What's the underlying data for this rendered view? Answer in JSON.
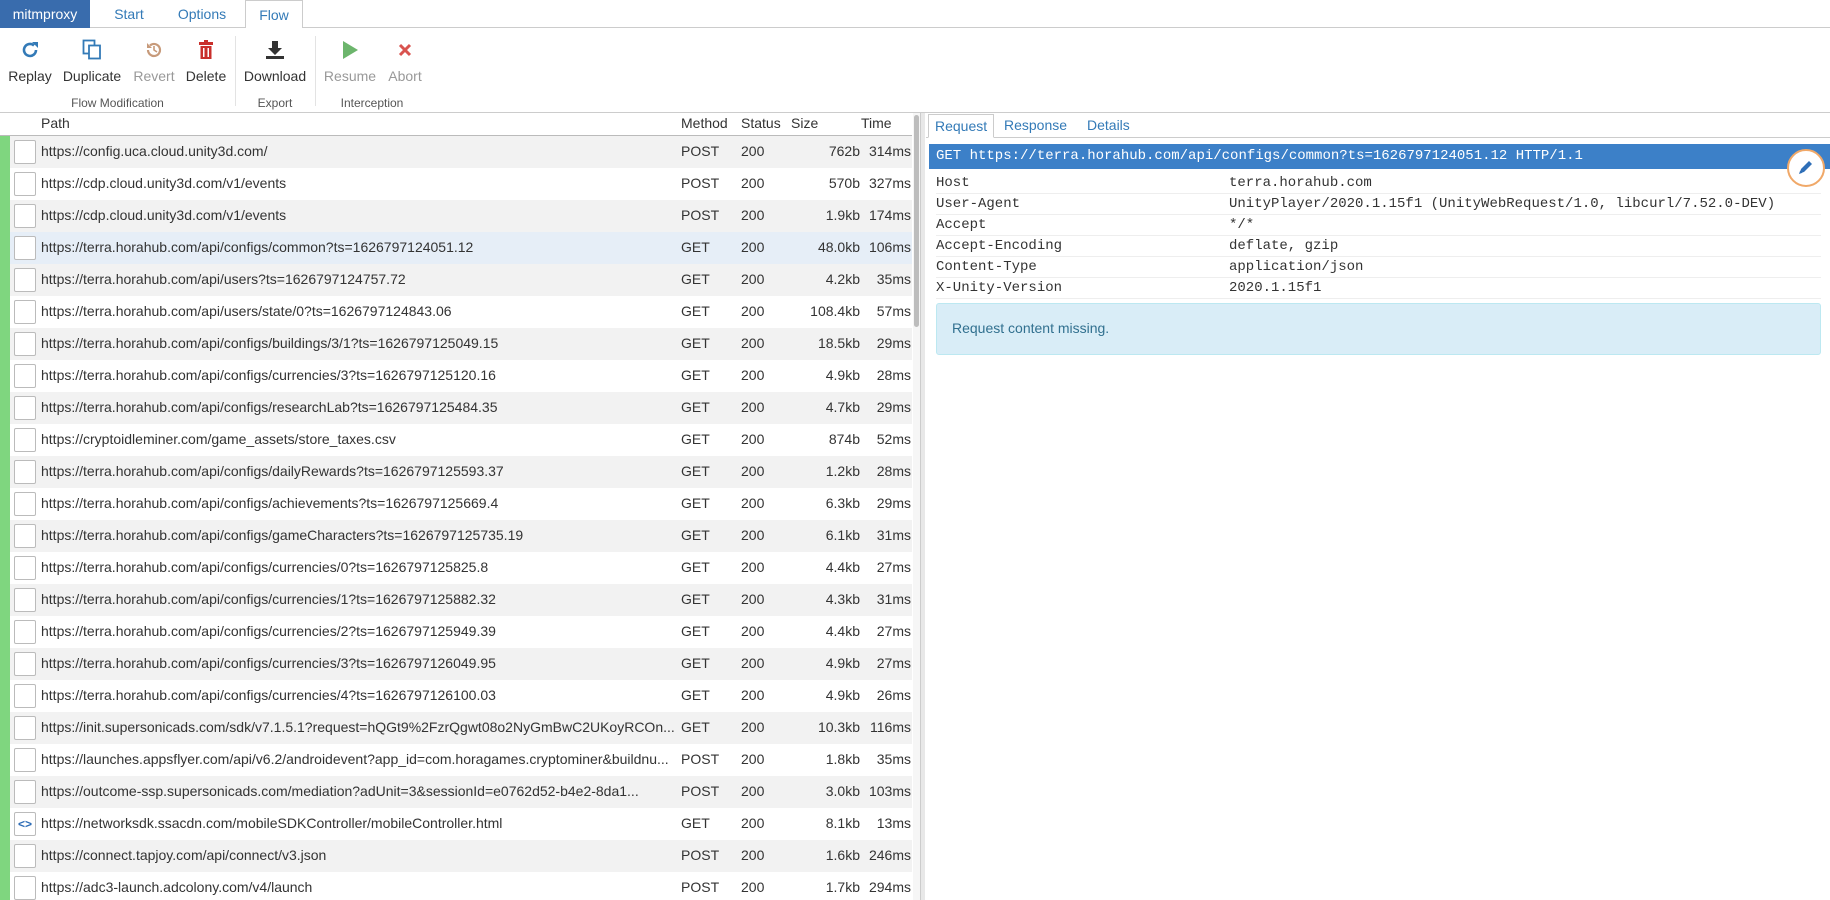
{
  "nav": {
    "brand": "mitmproxy",
    "tabs": [
      {
        "label": "Start"
      },
      {
        "label": "Options"
      },
      {
        "label": "Flow"
      }
    ]
  },
  "toolbar": {
    "replay": "Replay",
    "duplicate": "Duplicate",
    "revert": "Revert",
    "delete": "Delete",
    "download": "Download",
    "resume": "Resume",
    "abort": "Abort",
    "groups": {
      "flow_modification": "Flow Modification",
      "export": "Export",
      "interception": "Interception"
    }
  },
  "flow_table": {
    "columns": {
      "path": "Path",
      "method": "Method",
      "status": "Status",
      "size": "Size",
      "time": "Time"
    },
    "rows": [
      {
        "path": "https://config.uca.cloud.unity3d.com/",
        "method": "POST",
        "status": "200",
        "size": "762b",
        "time": "314ms"
      },
      {
        "path": "https://cdp.cloud.unity3d.com/v1/events",
        "method": "POST",
        "status": "200",
        "size": "570b",
        "time": "327ms"
      },
      {
        "path": "https://cdp.cloud.unity3d.com/v1/events",
        "method": "POST",
        "status": "200",
        "size": "1.9kb",
        "time": "174ms"
      },
      {
        "path": "https://terra.horahub.com/api/configs/common?ts=1626797124051.12",
        "method": "GET",
        "status": "200",
        "size": "48.0kb",
        "time": "106ms"
      },
      {
        "path": "https://terra.horahub.com/api/users?ts=1626797124757.72",
        "method": "GET",
        "status": "200",
        "size": "4.2kb",
        "time": "35ms"
      },
      {
        "path": "https://terra.horahub.com/api/users/state/0?ts=1626797124843.06",
        "method": "GET",
        "status": "200",
        "size": "108.4kb",
        "time": "57ms"
      },
      {
        "path": "https://terra.horahub.com/api/configs/buildings/3/1?ts=1626797125049.15",
        "method": "GET",
        "status": "200",
        "size": "18.5kb",
        "time": "29ms"
      },
      {
        "path": "https://terra.horahub.com/api/configs/currencies/3?ts=1626797125120.16",
        "method": "GET",
        "status": "200",
        "size": "4.9kb",
        "time": "28ms"
      },
      {
        "path": "https://terra.horahub.com/api/configs/researchLab?ts=1626797125484.35",
        "method": "GET",
        "status": "200",
        "size": "4.7kb",
        "time": "29ms"
      },
      {
        "path": "https://cryptoidleminer.com/game_assets/store_taxes.csv",
        "method": "GET",
        "status": "200",
        "size": "874b",
        "time": "52ms"
      },
      {
        "path": "https://terra.horahub.com/api/configs/dailyRewards?ts=1626797125593.37",
        "method": "GET",
        "status": "200",
        "size": "1.2kb",
        "time": "28ms"
      },
      {
        "path": "https://terra.horahub.com/api/configs/achievements?ts=1626797125669.4",
        "method": "GET",
        "status": "200",
        "size": "6.3kb",
        "time": "29ms"
      },
      {
        "path": "https://terra.horahub.com/api/configs/gameCharacters?ts=1626797125735.19",
        "method": "GET",
        "status": "200",
        "size": "6.1kb",
        "time": "31ms"
      },
      {
        "path": "https://terra.horahub.com/api/configs/currencies/0?ts=1626797125825.8",
        "method": "GET",
        "status": "200",
        "size": "4.4kb",
        "time": "27ms"
      },
      {
        "path": "https://terra.horahub.com/api/configs/currencies/1?ts=1626797125882.32",
        "method": "GET",
        "status": "200",
        "size": "4.3kb",
        "time": "31ms"
      },
      {
        "path": "https://terra.horahub.com/api/configs/currencies/2?ts=1626797125949.39",
        "method": "GET",
        "status": "200",
        "size": "4.4kb",
        "time": "27ms"
      },
      {
        "path": "https://terra.horahub.com/api/configs/currencies/3?ts=1626797126049.95",
        "method": "GET",
        "status": "200",
        "size": "4.9kb",
        "time": "27ms"
      },
      {
        "path": "https://terra.horahub.com/api/configs/currencies/4?ts=1626797126100.03",
        "method": "GET",
        "status": "200",
        "size": "4.9kb",
        "time": "26ms"
      },
      {
        "path": "https://init.supersonicads.com/sdk/v7.1.5.1?request=hQGt9%2FzrQgwt08o2NyGmBwC2UKoyRCOn...",
        "method": "GET",
        "status": "200",
        "size": "10.3kb",
        "time": "116ms"
      },
      {
        "path": "https://launches.appsflyer.com/api/v6.2/androidevent?app_id=com.horagames.cryptominer&buildnu...",
        "method": "POST",
        "status": "200",
        "size": "1.8kb",
        "time": "35ms"
      },
      {
        "path": "https://outcome-ssp.supersonicads.com/mediation?adUnit=3&sessionId=e0762d52-b4e2-8da1...",
        "method": "POST",
        "status": "200",
        "size": "3.0kb",
        "time": "103ms"
      },
      {
        "path": "https://networksdk.ssacdn.com/mobileSDKController/mobileController.html",
        "method": "GET",
        "status": "200",
        "size": "8.1kb",
        "time": "13ms"
      },
      {
        "path": "https://connect.tapjoy.com/api/connect/v3.json",
        "method": "POST",
        "status": "200",
        "size": "1.6kb",
        "time": "246ms"
      },
      {
        "path": "https://adc3-launch.adcolony.com/v4/launch",
        "method": "POST",
        "status": "200",
        "size": "1.7kb",
        "time": "294ms"
      }
    ]
  },
  "detail": {
    "tabs": {
      "request": "Request",
      "response": "Response",
      "details": "Details"
    },
    "request_line": "GET https://terra.horahub.com/api/configs/common?ts=1626797124051.12 HTTP/1.1",
    "headers": [
      {
        "key": "Host",
        "value": "terra.horahub.com"
      },
      {
        "key": "User-Agent",
        "value": "UnityPlayer/2020.1.15f1 (UnityWebRequest/1.0, libcurl/7.52.0-DEV)"
      },
      {
        "key": "Accept",
        "value": "*/*"
      },
      {
        "key": "Accept-Encoding",
        "value": "deflate, gzip"
      },
      {
        "key": "Content-Type",
        "value": "application/json"
      },
      {
        "key": "X-Unity-Version",
        "value": "2020.1.15f1"
      }
    ],
    "notice": "Request content missing."
  }
}
